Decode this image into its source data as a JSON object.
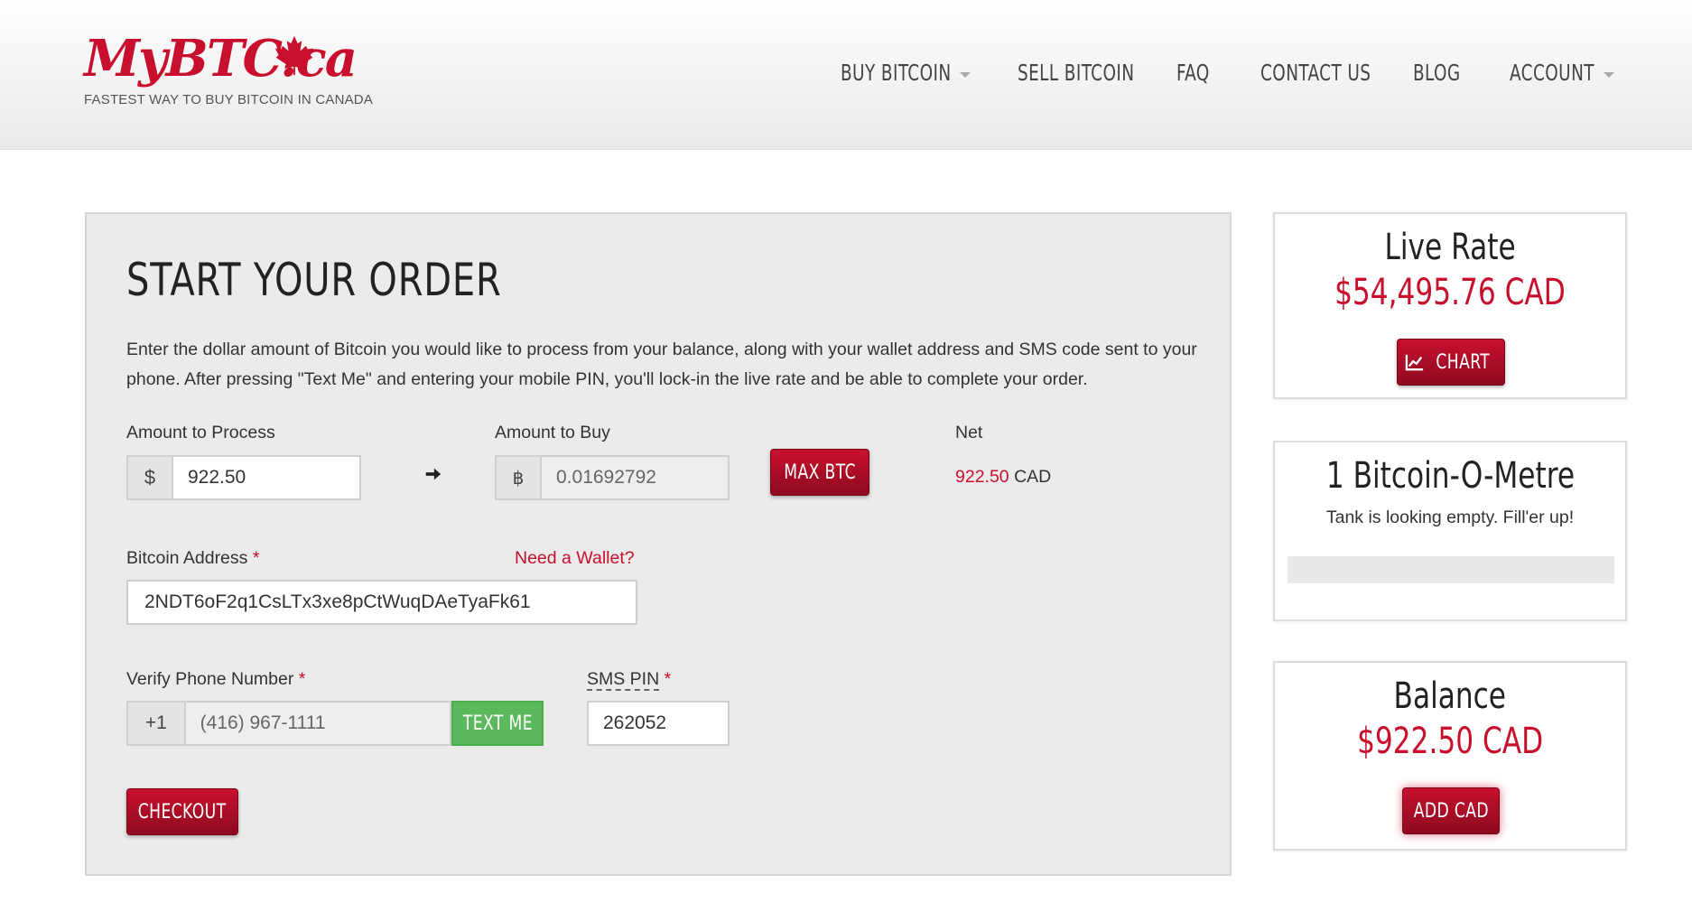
{
  "brand": {
    "logo_my": "My",
    "logo_rest": "BTC.ca",
    "tagline": "FASTEST WAY TO BUY BITCOIN IN CANADA"
  },
  "nav": {
    "items": [
      {
        "label": "BUY BITCOIN",
        "dropdown": true
      },
      {
        "label": "SELL BITCOIN",
        "dropdown": false
      },
      {
        "label": "FAQ",
        "dropdown": false
      },
      {
        "label": "CONTACT US",
        "dropdown": false
      },
      {
        "label": "BLOG",
        "dropdown": false
      },
      {
        "label": "ACCOUNT",
        "dropdown": true
      }
    ]
  },
  "order": {
    "title": "START YOUR ORDER",
    "description": "Enter the dollar amount of Bitcoin you would like to process from your balance, along with your wallet address and SMS code sent to your phone. After pressing \"Text Me\" and entering your mobile PIN, you'll lock-in the live rate and be able to complete your order.",
    "amount_process": {
      "label": "Amount to Process",
      "addon": "$",
      "value": "922.50"
    },
    "amount_buy": {
      "label": "Amount to Buy",
      "addon": "฿",
      "value": "0.01692792"
    },
    "max_btc_label": "MAX BTC",
    "net": {
      "label": "Net",
      "amount": "922.50",
      "currency": "CAD"
    },
    "bitcoin_address": {
      "label": "Bitcoin Address",
      "required": "*",
      "value": "2NDT6oF2q1CsLTx3xe8pCtWuqDAeTyaFk61"
    },
    "need_wallet": "Need a Wallet?",
    "phone": {
      "label": "Verify Phone Number",
      "required": "*",
      "country_code": "+1",
      "value": "(416) 967-1111"
    },
    "text_me_label": "TEXT ME",
    "sms_pin": {
      "label": "SMS PIN",
      "required": "*",
      "value": "262052"
    },
    "checkout_label": "CHECKOUT"
  },
  "sidebar": {
    "live_rate": {
      "title": "Live Rate",
      "price": "$54,495.76 CAD",
      "chart_label": "CHART"
    },
    "bitcoin_o_metre": {
      "title": "1 Bitcoin-O-Metre",
      "message": "Tank is looking empty. Fill'er up!",
      "fill_fraction": 0
    },
    "balance": {
      "title": "Balance",
      "amount": "$922.50 CAD",
      "add_label": "ADD CAD"
    }
  },
  "colors": {
    "brand_red": "#c8102e",
    "button_green": "#5cb85c",
    "panel_gray": "#ebebeb"
  }
}
